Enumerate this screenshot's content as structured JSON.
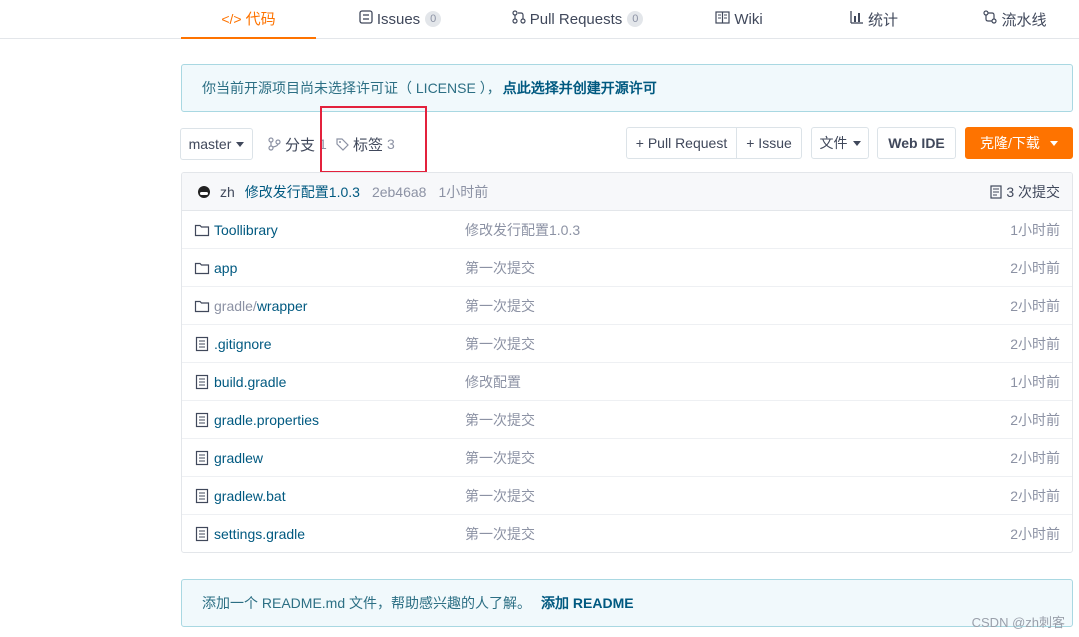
{
  "tabs": [
    {
      "label": "代码",
      "icon": "code-icon",
      "active": true
    },
    {
      "label": "Issues",
      "icon": "issues-icon",
      "count": "0"
    },
    {
      "label": "Pull Requests",
      "icon": "pull-request-icon",
      "count": "0"
    },
    {
      "label": "Wiki",
      "icon": "wiki-book-icon"
    },
    {
      "label": "统计",
      "icon": "stats-chart-icon"
    },
    {
      "label": "流水线",
      "icon": "pipeline-icon"
    }
  ],
  "license_notice": {
    "text": "你当前开源项目尚未选择许可证（ LICENSE ），",
    "link": "点此选择并创建开源许可"
  },
  "toolbar": {
    "branch": "master",
    "branches_label": "分支",
    "branches_count": "1",
    "tags_label": "标签",
    "tags_count": "3",
    "pull_request_button": "+ Pull Request",
    "issue_button": "+ Issue",
    "file_button": "文件",
    "web_ide_button": "Web IDE",
    "clone_button": "克隆/下载"
  },
  "latest_commit": {
    "author": "zh",
    "message": "修改发行配置1.0.3",
    "sha": "2eb46a8",
    "time": "1小时前",
    "commits_label": "3 次提交"
  },
  "files": [
    {
      "type": "folder",
      "name": "Toollibrary",
      "message": "修改发行配置1.0.3",
      "time": "1小时前"
    },
    {
      "type": "folder",
      "name": "app",
      "message": "第一次提交",
      "time": "2小时前"
    },
    {
      "type": "folder",
      "name_prefix": "gradle/",
      "name": "wrapper",
      "message": "第一次提交",
      "time": "2小时前"
    },
    {
      "type": "file",
      "name": ".gitignore",
      "message": "第一次提交",
      "time": "2小时前"
    },
    {
      "type": "file",
      "name": "build.gradle",
      "message": "修改配置",
      "time": "1小时前"
    },
    {
      "type": "file",
      "name": "gradle.properties",
      "message": "第一次提交",
      "time": "2小时前"
    },
    {
      "type": "file",
      "name": "gradlew",
      "message": "第一次提交",
      "time": "2小时前"
    },
    {
      "type": "file",
      "name": "gradlew.bat",
      "message": "第一次提交",
      "time": "2小时前"
    },
    {
      "type": "file",
      "name": "settings.gradle",
      "message": "第一次提交",
      "time": "2小时前"
    }
  ],
  "readme_notice": {
    "text": "添加一个 README.md 文件，帮助感兴趣的人了解。",
    "link": "添加 README"
  },
  "watermark": "CSDN @zh刺客",
  "colors": {
    "accent": "#fe7300",
    "link": "#005980",
    "highlight_box": "#e3213c"
  }
}
